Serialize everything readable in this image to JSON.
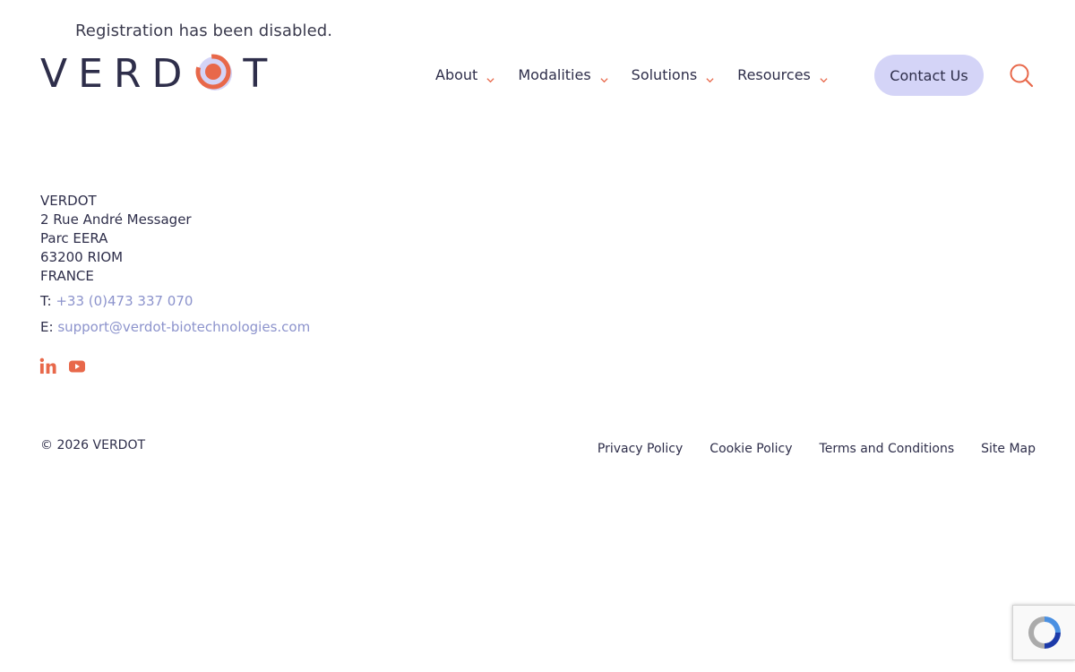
{
  "notice": "Registration has been disabled.",
  "logo": {
    "text_left": "VERD",
    "text_right": "T",
    "alt": "VERDOT"
  },
  "nav": {
    "items": [
      {
        "label": "About"
      },
      {
        "label": "Modalities"
      },
      {
        "label": "Solutions"
      },
      {
        "label": "Resources"
      }
    ],
    "contact_label": "Contact Us",
    "search_icon": "search-icon"
  },
  "footer": {
    "address": [
      "VERDOT",
      "2 Rue André Messager",
      "Parc EERA",
      "63200 RIOM",
      "FRANCE"
    ],
    "phone_prefix": "T: ",
    "phone": "+33 (0)473 337 070",
    "email_prefix": "E: ",
    "email": "support@verdot-biotechnologies.com",
    "social": [
      "linkedin-icon",
      "youtube-icon"
    ],
    "copyright": "© 2026 VERDOT",
    "links": [
      "Privacy Policy",
      "Cookie Policy",
      "Terms and Conditions",
      "Site Map"
    ]
  },
  "colors": {
    "accent": "#e8684a",
    "text": "#2e2e4a",
    "link": "#8c93cc",
    "button_bg": "#d4d4f7"
  }
}
